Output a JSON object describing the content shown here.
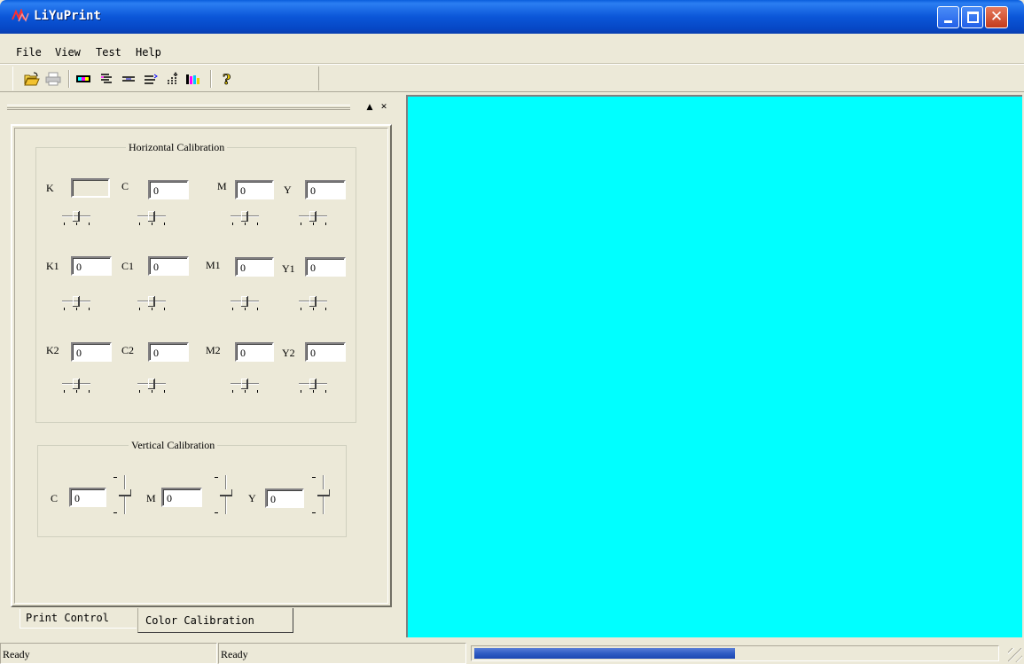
{
  "window": {
    "title": "LiYuPrint"
  },
  "menu": [
    {
      "label": "File"
    },
    {
      "label": "View"
    },
    {
      "label": "Test"
    },
    {
      "label": "Help"
    }
  ],
  "toolbar": {
    "icons": [
      "open-folder-icon",
      "print-icon",
      "color-bars-icon",
      "horizontal-lines-icon",
      "double-lines-icon",
      "lines-arrow-icon",
      "vertical-arrows-icon",
      "color-columns-icon",
      "help-icon"
    ]
  },
  "panel": {
    "horizontal_group_title": "Horizontal Calibration",
    "vertical_group_title": "Vertical Calibration",
    "horizontal": {
      "row1": [
        {
          "label": "K",
          "value": ""
        },
        {
          "label": "C",
          "value": "0"
        },
        {
          "label": "M",
          "value": "0"
        },
        {
          "label": "Y",
          "value": "0"
        }
      ],
      "row2": [
        {
          "label": "K1",
          "value": "0"
        },
        {
          "label": "C1",
          "value": "0"
        },
        {
          "label": "M1",
          "value": "0"
        },
        {
          "label": "Y1",
          "value": "0"
        }
      ],
      "row3": [
        {
          "label": "K2",
          "value": "0"
        },
        {
          "label": "C2",
          "value": "0"
        },
        {
          "label": "M2",
          "value": "0"
        },
        {
          "label": "Y2",
          "value": "0"
        }
      ]
    },
    "vertical": [
      {
        "label": "C",
        "value": "0"
      },
      {
        "label": "M",
        "value": "0"
      },
      {
        "label": "Y",
        "value": "0"
      }
    ]
  },
  "tabs": [
    {
      "label": "Print Control",
      "active": false
    },
    {
      "label": "Color Calibration",
      "active": true
    }
  ],
  "client_area": {
    "background": "#00ffff"
  },
  "status": {
    "pane1": "Ready",
    "pane2": "Ready",
    "progress": 0.5
  }
}
